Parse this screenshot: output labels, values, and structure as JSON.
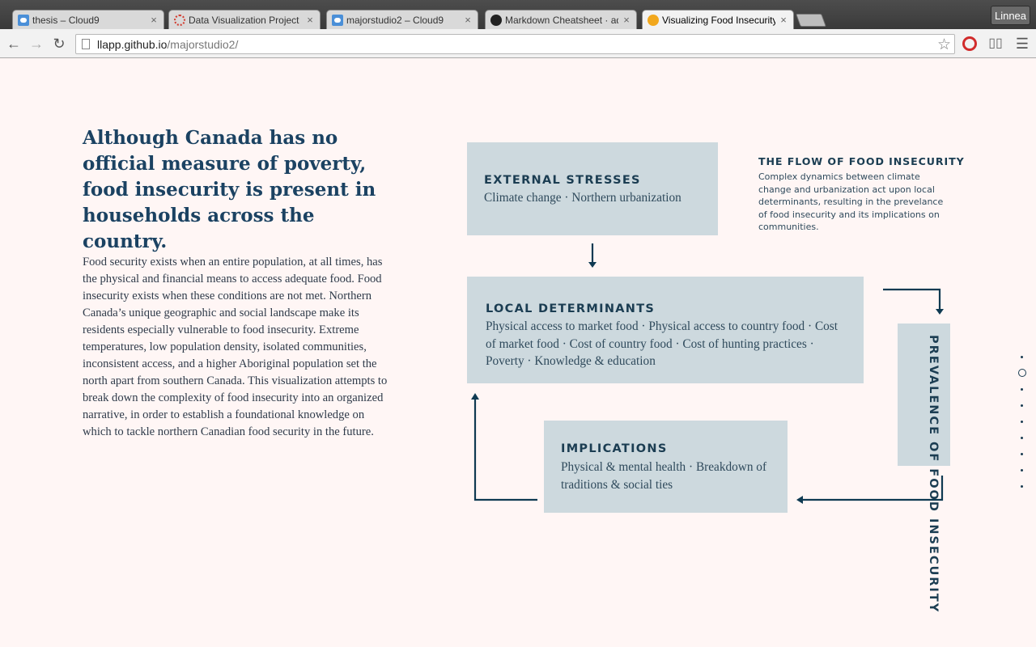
{
  "browser": {
    "tabs": [
      {
        "title": "thesis – Cloud9",
        "icon": "cloud9-icon",
        "active": false
      },
      {
        "title": "Data Visualization Project",
        "icon": "loading-spinner-icon",
        "active": false
      },
      {
        "title": "majorstudio2 – Cloud9",
        "icon": "cloud9-icon",
        "active": false
      },
      {
        "title": "Markdown Cheatsheet · ad",
        "icon": "github-icon",
        "active": false
      },
      {
        "title": "Visualizing Food Insecurity",
        "icon": "orange-dot-icon",
        "active": true
      }
    ],
    "profile_name": "Linnea",
    "url_host": "llapp.github.io",
    "url_path": "/majorstudio2/"
  },
  "article": {
    "headline": "Although Canada has no official measure of poverty, food insecurity is present in households across the country.",
    "intro": "Food security exists when an entire population, at all times, has the physical and financial means to access adequate food. Food insecurity exists when these conditions are not met. Northern Canada’s unique geographic and social landscape make its residents especially vulnerable to food insecurity. Extreme temperatures, low population density, isolated communities, inconsistent access, and a higher Aboriginal population set the north apart from southern Canada. This visualization attempts to break down the complexity of food insecurity into an organized narrative, in order to establish a foundational knowledge on which to tackle northern Canadian food security in the future."
  },
  "diagram": {
    "heading": "THE FLOW OF FOOD INSECURITY",
    "description": "Complex dynamics between climate change and urbanization act upon local determinants, resulting in the prevelance of food insecurity and its implications on communities.",
    "external": {
      "title": "EXTERNAL STRESSES",
      "text": "Climate change · Northern urbanization"
    },
    "local": {
      "title": "LOCAL DETERMINANTS",
      "text": "Physical access to market food · Physical access to country food · Cost of market food · Cost of country food · Cost of hunting practices · Poverty · Knowledge & education"
    },
    "implications": {
      "title": "IMPLICATIONS",
      "text": "Physical & mental health · Breakdown of traditions & social ties"
    },
    "prevalence": {
      "title": "PREVALENCE OF FOOD INSECURITY"
    },
    "colors": {
      "box": "#cdd9de",
      "ink": "#1b3d52",
      "arrow": "#0f3a52",
      "page": "#fff6f5"
    }
  },
  "scroll_nav": {
    "count": 9,
    "active_index": 1
  }
}
